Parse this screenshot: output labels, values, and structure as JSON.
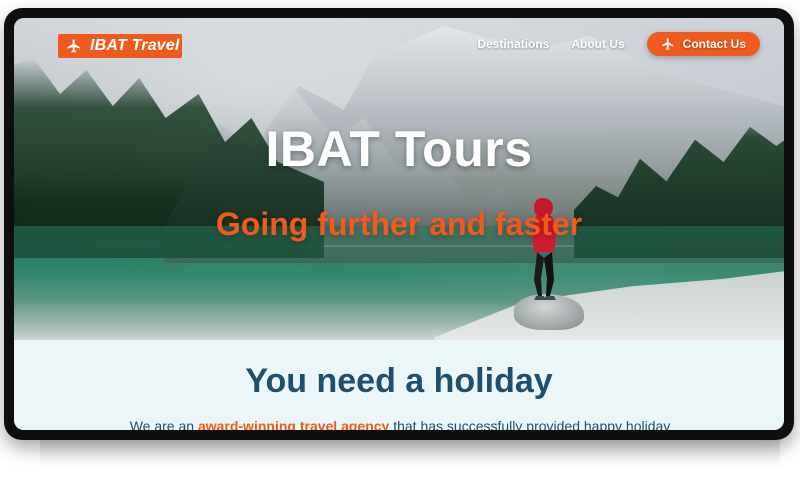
{
  "brand": {
    "name": "IBAT Travel",
    "icon": "airplane-icon",
    "color": "#f05a1d"
  },
  "nav": {
    "items": [
      {
        "label": "Destinations"
      },
      {
        "label": "About Us"
      }
    ],
    "contact": {
      "label": "Contact Us",
      "icon": "airplane-icon"
    }
  },
  "hero": {
    "title": "IBAT Tours",
    "subtitle": "Going further and faster"
  },
  "intro": {
    "heading": "You need a holiday",
    "text_before": "We are an",
    "highlight": "award-winning travel agency",
    "text_after": "that has successfully provided happy holiday experiences for thousands of customers for over a decade. Whether you are planning"
  },
  "colors": {
    "accent": "#f05a1d",
    "heading": "#1f4f6b",
    "content_bg": "#eaf6f7"
  }
}
